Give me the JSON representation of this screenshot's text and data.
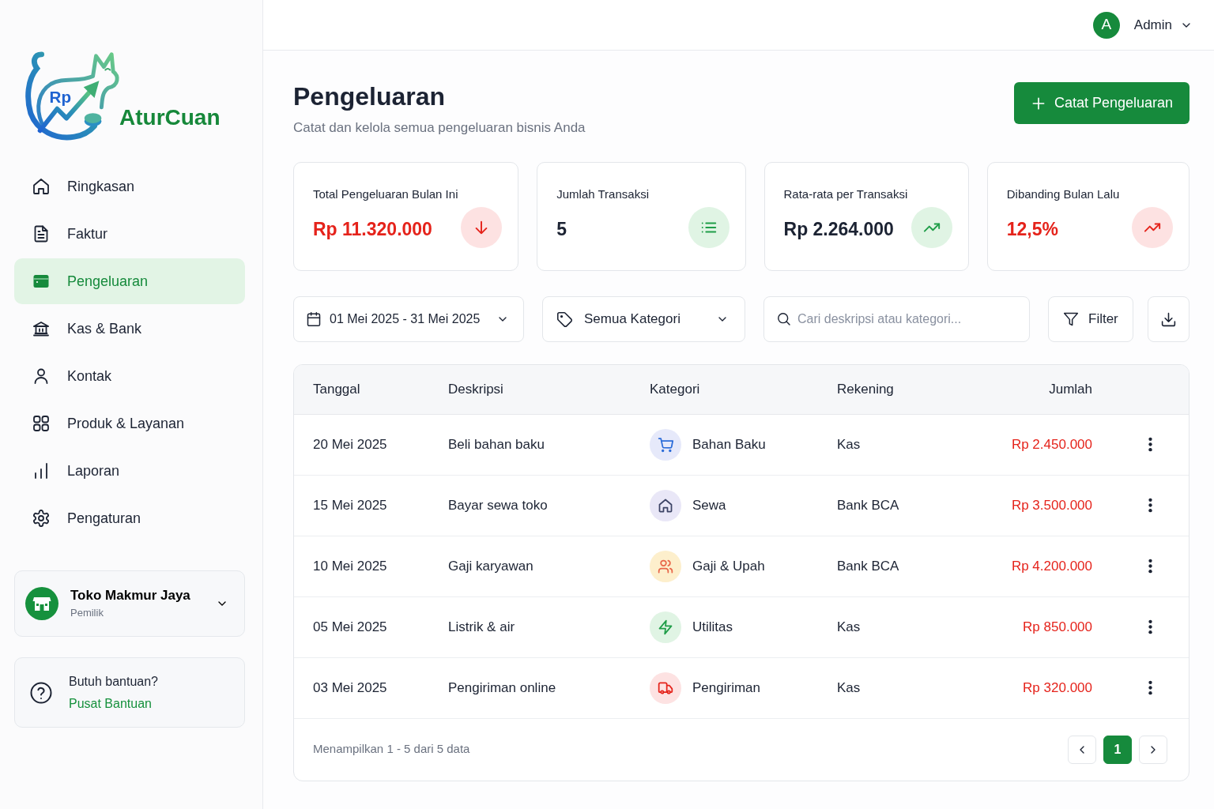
{
  "sidebar": {
    "logo": {
      "mark_text": "Rp",
      "brand": "AturCuan"
    },
    "nav": [
      {
        "label": "Ringkasan",
        "kind": "home",
        "selected": false
      },
      {
        "label": "Faktur",
        "kind": "file",
        "selected": false
      },
      {
        "label": "Pengeluaran",
        "kind": "wallet",
        "selected": true
      },
      {
        "label": "Kas & Bank",
        "kind": "bank",
        "selected": false
      },
      {
        "label": "Kontak",
        "kind": "user",
        "selected": false
      },
      {
        "label": "Produk & Layanan",
        "kind": "grid",
        "selected": false
      },
      {
        "label": "Laporan",
        "kind": "chart",
        "selected": false
      },
      {
        "label": "Pengaturan",
        "kind": "gear",
        "selected": false
      }
    ],
    "account": {
      "name": "Toko Makmur Jaya",
      "role": "Pemilik"
    },
    "help": {
      "title": "Butuh bantuan?",
      "link": "Pusat Bantuan"
    }
  },
  "header": {
    "user": {
      "initial": "A",
      "name": "Admin"
    }
  },
  "page": {
    "title": "Pengeluaran",
    "subtitle": "Catat dan kelola semua pengeluaran bisnis Anda",
    "primary_button": "Catat Pengeluaran"
  },
  "stats": [
    {
      "label": "Total Pengeluaran Bulan Ini",
      "value": "Rp 11.320.000",
      "negative": true,
      "kind": "arrow-down"
    },
    {
      "label": "Jumlah Transaksi",
      "value": "5",
      "negative": false,
      "kind": "list"
    },
    {
      "label": "Rata-rata per Transaksi",
      "value": "Rp 2.264.000",
      "negative": false,
      "kind": "trend-up"
    },
    {
      "label": "Dibanding Bulan Lalu",
      "value": "12,5%",
      "negative": true,
      "kind": "trend-up"
    }
  ],
  "filters": {
    "date_range": "01 Mei 2025 - 31 Mei 2025",
    "category": "Semua Kategori",
    "search": {
      "placeholder": "Cari deskripsi atau kategori..."
    },
    "filter_button": "Filter"
  },
  "table": {
    "columns": [
      "Tanggal",
      "Deskripsi",
      "Kategori",
      "Rekening",
      "Jumlah"
    ],
    "rows": [
      {
        "date": "20 Mei 2025",
        "description": "Beli bahan baku",
        "category": {
          "label": "Bahan Baku",
          "kind": "cart",
          "color": "#e6e9fa"
        },
        "account": "Kas",
        "amount": "Rp 2.450.000"
      },
      {
        "date": "15 Mei 2025",
        "description": "Bayar sewa toko",
        "category": {
          "label": "Sewa",
          "kind": "home",
          "color": "#e9e7f7"
        },
        "account": "Bank BCA",
        "amount": "Rp 3.500.000"
      },
      {
        "date": "10 Mei 2025",
        "description": "Gaji karyawan",
        "category": {
          "label": "Gaji & Upah",
          "kind": "people",
          "color": "#fdefcc"
        },
        "account": "Bank BCA",
        "amount": "Rp 4.200.000"
      },
      {
        "date": "05 Mei 2025",
        "description": "Listrik & air",
        "category": {
          "label": "Utilitas",
          "kind": "bolt",
          "color": "#e0f4e4"
        },
        "account": "Kas",
        "amount": "Rp 850.000"
      },
      {
        "date": "03 Mei 2025",
        "description": "Pengiriman online",
        "category": {
          "label": "Pengiriman",
          "kind": "truck",
          "color": "#fde2e2"
        },
        "account": "Kas",
        "amount": "Rp 320.000"
      }
    ],
    "footer": {
      "summary": "Menampilkan 1 - 5 dari 5 data",
      "pages": [
        {
          "label": "1",
          "selected": true
        }
      ]
    }
  }
}
